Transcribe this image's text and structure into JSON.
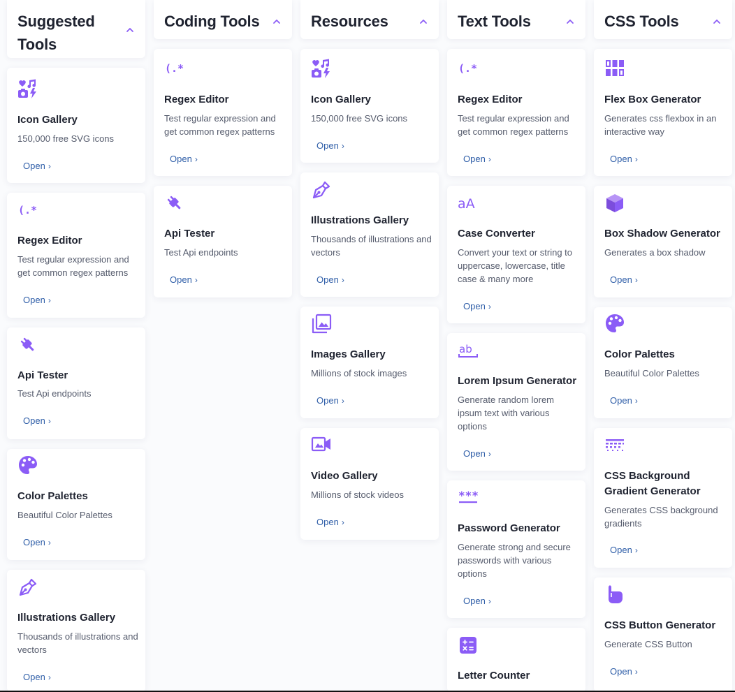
{
  "colors": {
    "accent": "#8b5cf6",
    "link": "#2f5ea8"
  },
  "columns": [
    {
      "title": "Suggested Tools",
      "cards": [
        {
          "icon": "icon-gallery-icon",
          "title": "Icon Gallery",
          "desc": "150,000 free SVG icons",
          "link": "Open"
        },
        {
          "icon": "regex-icon",
          "title": "Regex Editor",
          "desc": "Test regular expression and get common regex patterns",
          "link": "Open"
        },
        {
          "icon": "plug-icon",
          "title": "Api Tester",
          "desc": "Test Api endpoints",
          "link": "Open"
        },
        {
          "icon": "palette-icon",
          "title": "Color Palettes",
          "desc": "Beautiful Color Palettes",
          "link": "Open"
        },
        {
          "icon": "pen-nib-icon",
          "title": "Illustrations Gallery",
          "desc": "Thousands of illustrations and vectors",
          "link": "Open"
        }
      ]
    },
    {
      "title": "Coding Tools",
      "cards": [
        {
          "icon": "regex-icon",
          "title": "Regex Editor",
          "desc": "Test regular expression and get common regex patterns",
          "link": "Open"
        },
        {
          "icon": "plug-icon",
          "title": "Api Tester",
          "desc": "Test Api endpoints",
          "link": "Open"
        }
      ]
    },
    {
      "title": "Resources",
      "cards": [
        {
          "icon": "icon-gallery-icon",
          "title": "Icon Gallery",
          "desc": "150,000 free SVG icons",
          "link": "Open"
        },
        {
          "icon": "pen-nib-icon",
          "title": "Illustrations Gallery",
          "desc": "Thousands of illustrations and vectors",
          "link": "Open"
        },
        {
          "icon": "image-gallery-icon",
          "title": "Images Gallery",
          "desc": "Millions of stock images",
          "link": "Open"
        },
        {
          "icon": "video-icon",
          "title": "Video Gallery",
          "desc": "Millions of stock videos",
          "link": "Open"
        }
      ]
    },
    {
      "title": "Text Tools",
      "cards": [
        {
          "icon": "regex-icon",
          "title": "Regex Editor",
          "desc": "Test regular expression and get common regex patterns",
          "link": "Open"
        },
        {
          "icon": "case-icon",
          "title": "Case Converter",
          "desc": "Convert your text or string to uppercase, lowercase, title case & many more",
          "link": "Open"
        },
        {
          "icon": "ab-text-icon",
          "title": "Lorem Ipsum Generator",
          "desc": "Generate random lorem ipsum text with various options",
          "link": "Open"
        },
        {
          "icon": "password-icon",
          "title": "Password Generator",
          "desc": "Generate strong and secure passwords with various options",
          "link": "Open"
        },
        {
          "icon": "calculator-icon",
          "title": "Letter Counter",
          "desc": "",
          "link": ""
        }
      ]
    },
    {
      "title": "CSS Tools",
      "cards": [
        {
          "icon": "flexbox-icon",
          "title": "Flex Box Generator",
          "desc": "Generates css flexbox in an interactive way",
          "link": "Open"
        },
        {
          "icon": "cube-icon",
          "title": "Box Shadow Generator",
          "desc": "Generates a box shadow",
          "link": "Open"
        },
        {
          "icon": "palette-icon",
          "title": "Color Palettes",
          "desc": "Beautiful Color Palettes",
          "link": "Open"
        },
        {
          "icon": "gradient-icon",
          "title": "CSS Background Gradient Generator",
          "desc": "Generates CSS background gradients",
          "link": "Open"
        },
        {
          "icon": "mouse-pointer-icon",
          "title": "CSS Button Generator",
          "desc": "Generate CSS Button",
          "link": "Open"
        }
      ]
    }
  ]
}
